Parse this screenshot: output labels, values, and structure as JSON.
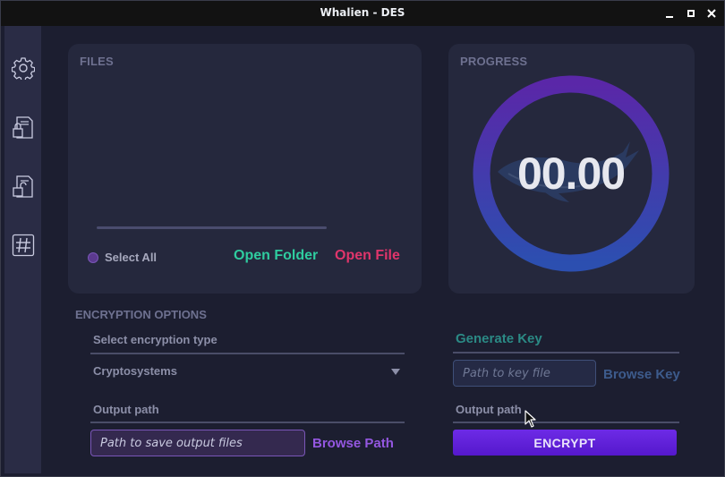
{
  "window": {
    "title": "Whalien - DES"
  },
  "sidebar": {
    "items": [
      {
        "icon": "gear-icon"
      },
      {
        "icon": "encrypt-document-icon"
      },
      {
        "icon": "decrypt-document-icon"
      },
      {
        "icon": "hash-icon"
      }
    ]
  },
  "files": {
    "title": "FILES",
    "select_all_label": "Select All",
    "open_folder_label": "Open Folder",
    "open_file_label": "Open File"
  },
  "progress": {
    "title": "PROGRESS",
    "value": "00.00",
    "ring_gradient": [
      "#5a27a8",
      "#2c4fb0"
    ]
  },
  "encryption_options": {
    "title": "ENCRYPTION OPTIONS",
    "select_type_label": "Select encryption type",
    "cryptosystem_selected": "Cryptosystems",
    "output_path_label": "Output path",
    "output_path_placeholder": "Path to save output files",
    "browse_path_label": "Browse Path"
  },
  "key": {
    "generate_label": "Generate Key",
    "key_path_placeholder": "Path to key file",
    "browse_key_label": "Browse Key",
    "output_path_label": "Output path"
  },
  "encrypt_button_label": "ENCRYPT",
  "colors": {
    "accent_green": "#2fcc9f",
    "accent_pink": "#e0356b",
    "accent_purple": "#9457e0",
    "button_purple": "#6d2be6"
  }
}
